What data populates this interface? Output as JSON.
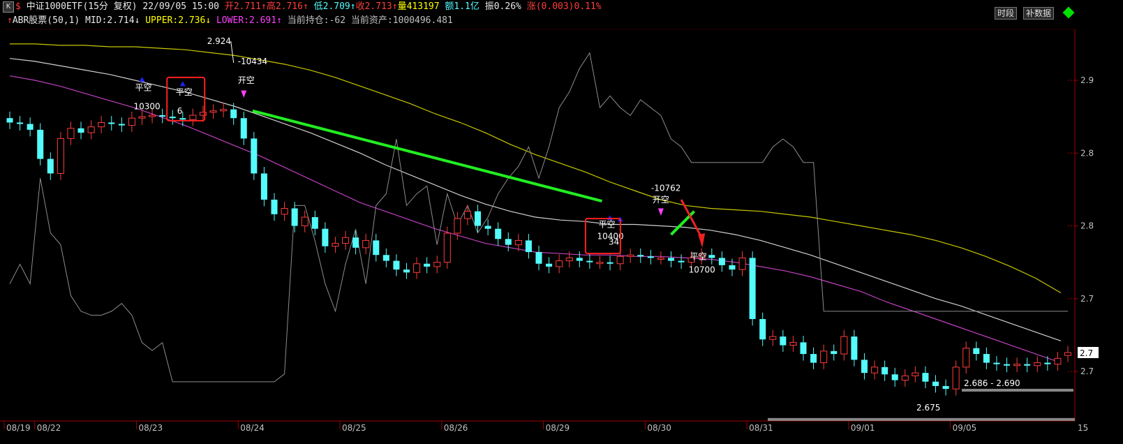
{
  "header": {
    "k_button": "K",
    "dollar": "$",
    "title": "中证1000ETF(15分 复权)",
    "datetime": "22/09/05 15:00",
    "open_label": "开",
    "open_value": "2.711",
    "high_label": "高",
    "high_value": "2.716",
    "low_label": "低",
    "low_value": "2.709",
    "close_label": "收",
    "close_value": "2.713",
    "volume_label": "量",
    "volume_value": "413197",
    "amount_label": "额",
    "amount_value": "1.1亿",
    "amplitude_label": "振",
    "amplitude_value": "0.26%",
    "change_label": "涨",
    "change_value": "(0.003)0.11%",
    "up_arrow": "↑",
    "down_arrow": "↓"
  },
  "indicator": {
    "name": "ABR股票(50,1)",
    "mid_label": "MID:",
    "mid_value": "2.714",
    "upper_label": "UPPER:",
    "upper_value": "2.736",
    "lower_label": "LOWER:",
    "lower_value": "2.691",
    "position_label": "当前持仓:",
    "position_value": "-62",
    "assets_label": "当前资产:",
    "assets_value": "1000496.481"
  },
  "toolbar": {
    "period_button": "时段",
    "fill_data_button": "补数据"
  },
  "colors": {
    "up": "#ff3c3c",
    "down": "#54fcfc",
    "upper": "#c8c800",
    "mid": "#d0d0d0",
    "lower": "#c040c0",
    "position_line": "#8c8c8c",
    "green_line": "#22ee22",
    "red_arrow": "#ee2222",
    "axis": "#a00000",
    "highlight_box": "#ff2020",
    "buy_marker": "#2020ff",
    "sell_marker": "#ff40ff"
  },
  "chart_data": {
    "type": "candlestick",
    "y_tick_labels": [
      "2.9",
      "2.8",
      "2.8",
      "2.7",
      "2.7"
    ],
    "y_tick_values": [
      2.9,
      2.85,
      2.8,
      2.75,
      2.7
    ],
    "right_edge_label": "2.7",
    "y_range": [
      2.666,
      2.935
    ],
    "date_labels": [
      "08/19",
      "08/22",
      "08/23",
      "08/24",
      "08/25",
      "08/26",
      "08/29",
      "08/30",
      "08/31",
      "09/01",
      "09/05"
    ],
    "date_bar_index": [
      0,
      3,
      13,
      23,
      33,
      43,
      53,
      63,
      73,
      83,
      93
    ],
    "last_date_partial": "15",
    "candles_close": [
      2.871,
      2.87,
      2.866,
      2.846,
      2.836,
      2.86,
      2.867,
      2.864,
      2.868,
      2.871,
      2.87,
      2.869,
      2.874,
      2.875,
      2.876,
      2.875,
      2.874,
      2.873,
      2.876,
      2.878,
      2.879,
      2.88,
      2.874,
      2.86,
      2.836,
      2.818,
      2.808,
      2.812,
      2.8,
      2.806,
      2.798,
      2.786,
      2.788,
      2.792,
      2.785,
      2.79,
      2.78,
      2.776,
      2.77,
      2.768,
      2.774,
      2.772,
      2.775,
      2.795,
      2.805,
      2.81,
      2.8,
      2.798,
      2.791,
      2.787,
      2.79,
      2.782,
      2.774,
      2.772,
      2.776,
      2.778,
      2.776,
      2.775,
      2.775,
      2.774,
      2.779,
      2.78,
      2.779,
      2.778,
      2.778,
      2.776,
      2.775,
      2.778,
      2.78,
      2.778,
      2.773,
      2.77,
      2.778,
      2.736,
      2.722,
      2.724,
      2.718,
      2.72,
      2.712,
      2.706,
      2.714,
      2.712,
      2.724,
      2.708,
      2.699,
      2.703,
      2.698,
      2.694,
      2.697,
      2.699,
      2.693,
      2.69,
      2.688,
      2.703,
      2.716,
      2.712,
      2.706,
      2.705,
      2.704,
      2.705,
      2.704,
      2.706,
      2.705,
      2.709,
      2.713
    ],
    "candles_open": [
      2.874,
      2.871,
      2.87,
      2.866,
      2.846,
      2.836,
      2.86,
      2.867,
      2.864,
      2.868,
      2.871,
      2.87,
      2.869,
      2.874,
      2.875,
      2.876,
      2.875,
      2.874,
      2.873,
      2.876,
      2.878,
      2.879,
      2.88,
      2.874,
      2.86,
      2.836,
      2.818,
      2.808,
      2.812,
      2.8,
      2.806,
      2.798,
      2.786,
      2.788,
      2.792,
      2.785,
      2.79,
      2.78,
      2.776,
      2.77,
      2.768,
      2.774,
      2.772,
      2.775,
      2.795,
      2.805,
      2.81,
      2.8,
      2.798,
      2.791,
      2.787,
      2.79,
      2.782,
      2.774,
      2.772,
      2.776,
      2.778,
      2.776,
      2.775,
      2.775,
      2.774,
      2.779,
      2.78,
      2.779,
      2.778,
      2.778,
      2.776,
      2.775,
      2.778,
      2.78,
      2.778,
      2.773,
      2.77,
      2.778,
      2.736,
      2.722,
      2.724,
      2.718,
      2.72,
      2.712,
      2.706,
      2.714,
      2.712,
      2.724,
      2.708,
      2.699,
      2.703,
      2.698,
      2.694,
      2.697,
      2.699,
      2.693,
      2.69,
      2.688,
      2.703,
      2.716,
      2.712,
      2.706,
      2.705,
      2.704,
      2.705,
      2.704,
      2.706,
      2.705,
      2.711
    ],
    "upper_band": [
      2.925,
      2.925,
      2.924,
      2.924,
      2.923,
      2.923,
      2.922,
      2.921,
      2.919,
      2.917,
      2.914,
      2.911,
      2.907,
      2.902,
      2.896,
      2.89,
      2.884,
      2.877,
      2.871,
      2.864,
      2.856,
      2.849,
      2.843,
      2.837,
      2.83,
      2.824,
      2.818,
      2.814,
      2.812,
      2.811,
      2.81,
      2.808,
      2.806,
      2.803,
      2.8,
      2.797,
      2.794,
      2.79,
      2.785,
      2.779,
      2.772,
      2.764,
      2.754
    ],
    "mid_band": [
      2.915,
      2.913,
      2.91,
      2.907,
      2.904,
      2.9,
      2.896,
      2.892,
      2.887,
      2.882,
      2.876,
      2.87,
      2.864,
      2.857,
      2.85,
      2.842,
      2.835,
      2.828,
      2.821,
      2.815,
      2.81,
      2.806,
      2.804,
      2.803,
      2.801,
      2.801,
      2.8,
      2.799,
      2.797,
      2.794,
      2.79,
      2.785,
      2.78,
      2.774,
      2.768,
      2.762,
      2.756,
      2.75,
      2.745,
      2.739,
      2.733,
      2.727,
      2.721
    ],
    "lower_band": [
      2.903,
      2.9,
      2.896,
      2.891,
      2.886,
      2.881,
      2.875,
      2.869,
      2.862,
      2.855,
      2.848,
      2.84,
      2.832,
      2.824,
      2.816,
      2.81,
      2.804,
      2.798,
      2.793,
      2.788,
      2.785,
      2.782,
      2.781,
      2.78,
      2.78,
      2.779,
      2.779,
      2.778,
      2.777,
      2.775,
      2.772,
      2.769,
      2.765,
      2.76,
      2.755,
      2.748,
      2.742,
      2.736,
      2.73,
      2.724,
      2.718,
      2.712,
      2.706
    ],
    "position_line": [
      0.35,
      0.4,
      0.35,
      0.62,
      0.48,
      0.45,
      0.32,
      0.28,
      0.27,
      0.27,
      0.28,
      0.3,
      0.27,
      0.2,
      0.18,
      0.2,
      0.1,
      0.1,
      0.1,
      0.1,
      0.1,
      0.1,
      0.1,
      0.1,
      0.1,
      0.1,
      0.1,
      0.12,
      0.55,
      0.55,
      0.46,
      0.35,
      0.28,
      0.4,
      0.49,
      0.35,
      0.55,
      0.58,
      0.72,
      0.55,
      0.58,
      0.6,
      0.45,
      0.58,
      0.5,
      0.55,
      0.48,
      0.52,
      0.58,
      0.62,
      0.65,
      0.7,
      0.62,
      0.7,
      0.8,
      0.84,
      0.9,
      0.94,
      0.8,
      0.83,
      0.8,
      0.78,
      0.82,
      0.8,
      0.78,
      0.72,
      0.7,
      0.66,
      0.66,
      0.66,
      0.66,
      0.66,
      0.66,
      0.66,
      0.66,
      0.7,
      0.72,
      0.7,
      0.66,
      0.66,
      0.28,
      0.28,
      0.28,
      0.28,
      0.28,
      0.28,
      0.28,
      0.28,
      0.28,
      0.28,
      0.28,
      0.28,
      0.28,
      0.28,
      0.28,
      0.28,
      0.28,
      0.28,
      0.28,
      0.28,
      0.28,
      0.28,
      0.28,
      0.28,
      0.28
    ],
    "annotations": {
      "high_price": "2.924",
      "signal_1": "-10434",
      "signal_2": "-10762",
      "open_short": "开空",
      "close_short": "平空",
      "qty_10300": "10300",
      "qty_6": "6",
      "qty_10400": "10400",
      "qty_34": "34",
      "qty_10700": "10700",
      "range_label": "2.686 - 2.690",
      "low_price": "2.675"
    }
  }
}
